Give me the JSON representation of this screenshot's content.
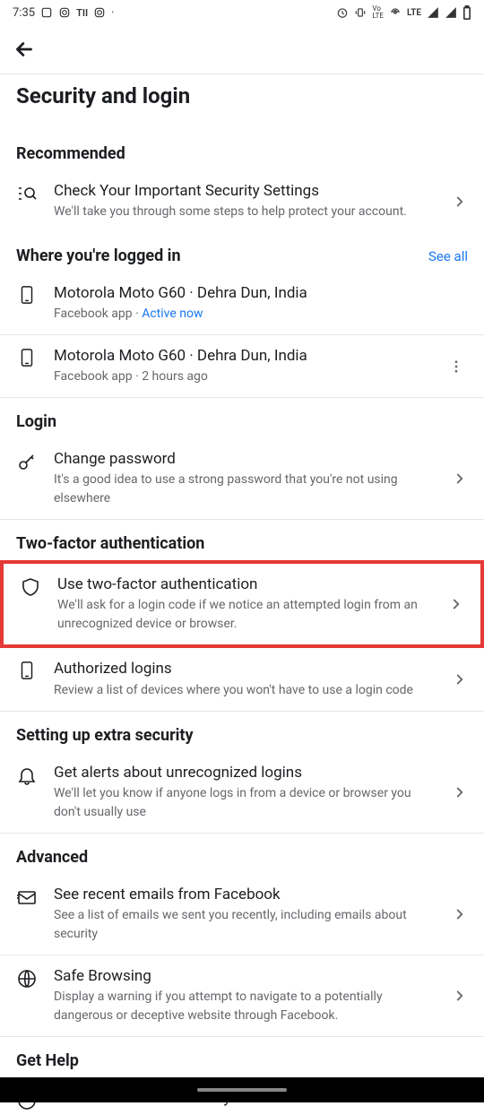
{
  "statusbar": {
    "time": "7:35",
    "lte": "LTE"
  },
  "page": {
    "title": "Security and login"
  },
  "sections": {
    "recommended": {
      "header": "Recommended",
      "check": {
        "title": "Check Your Important Security Settings",
        "sub": "We'll take you through some steps to help protect your account."
      }
    },
    "where": {
      "header": "Where you're logged in",
      "see_all": "See all",
      "d0": {
        "title": "Motorola Moto G60 · Dehra Dun, India",
        "sub_prefix": "Facebook app · ",
        "sub_status": "Active now"
      },
      "d1": {
        "title": "Motorola Moto G60 · Dehra Dun, India",
        "sub": "Facebook app · 2 hours ago"
      }
    },
    "login": {
      "header": "Login",
      "cp": {
        "title": "Change password",
        "sub": "It's a good idea to use a strong password that you're not using elsewhere"
      }
    },
    "twofa": {
      "header": "Two-factor authentication",
      "use": {
        "title": "Use two-factor authentication",
        "sub": "We'll ask for a login code if we notice an attempted login from an unrecognized device or browser."
      },
      "auth": {
        "title": "Authorized logins",
        "sub": "Review a list of devices where you won't have to use a login code"
      }
    },
    "extra": {
      "header": "Setting up extra security",
      "alerts": {
        "title": "Get alerts about unrecognized logins",
        "sub": "We'll let you know if anyone logs in from a device or browser you don't usually use"
      }
    },
    "advanced": {
      "header": "Advanced",
      "emails": {
        "title": "See recent emails from Facebook",
        "sub": "See a list of emails we sent you recently, including emails about security"
      },
      "safe": {
        "title": "Safe Browsing",
        "sub": "Display a warning if you attempt to navigate to a potentially dangerous or deceptive website through Facebook."
      }
    },
    "help": {
      "header": "Get Help",
      "learn": {
        "title": "Learn more about security"
      }
    }
  }
}
